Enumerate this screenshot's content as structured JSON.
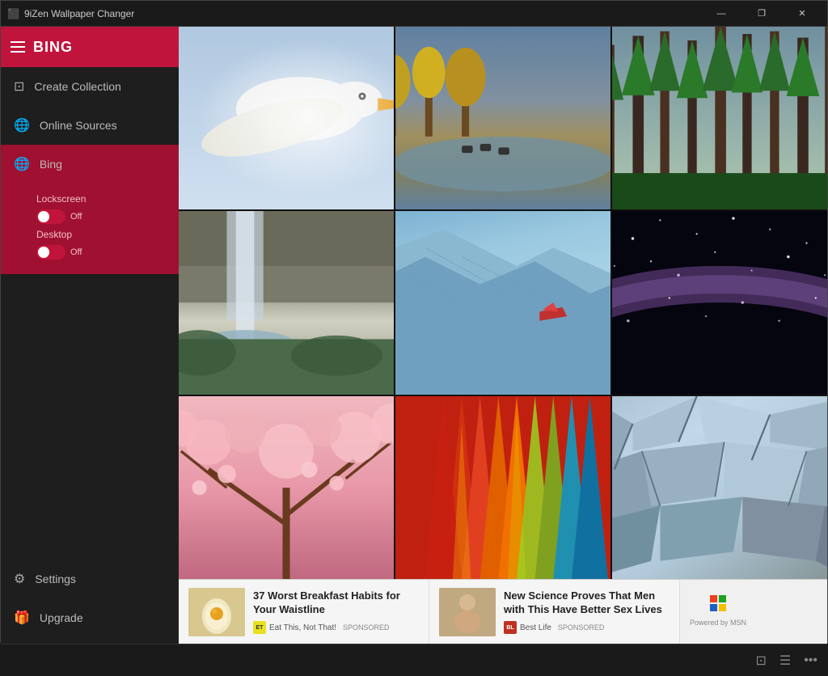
{
  "titlebar": {
    "title": "9iZen Wallpaper Changer",
    "minimize": "—",
    "maximize": "❐",
    "close": "✕"
  },
  "sidebar": {
    "header": {
      "title": "BING"
    },
    "nav": {
      "create_collection": "Create Collection",
      "online_sources": "Online Sources",
      "bing": "Bing",
      "lockscreen_label": "Lockscreen",
      "lockscreen_state": "Off",
      "desktop_label": "Desktop",
      "desktop_state": "Off"
    },
    "bottom": {
      "settings": "Settings",
      "upgrade": "Upgrade"
    }
  },
  "ads": {
    "ad1": {
      "title": "37 Worst Breakfast Habits for Your Waistline",
      "source": "Eat This, Not That!",
      "sponsored": "SPONSORED",
      "logo_text": "ET"
    },
    "ad2": {
      "title": "New Science Proves That Men with This Have Better Sex Lives",
      "source": "Best Life",
      "sponsored": "SPONSORED",
      "logo_text": "BL"
    },
    "msn": "Powered by MSN"
  },
  "statusbar": {
    "icon1": "⊡",
    "icon2": "☰",
    "icon3": "•••"
  }
}
